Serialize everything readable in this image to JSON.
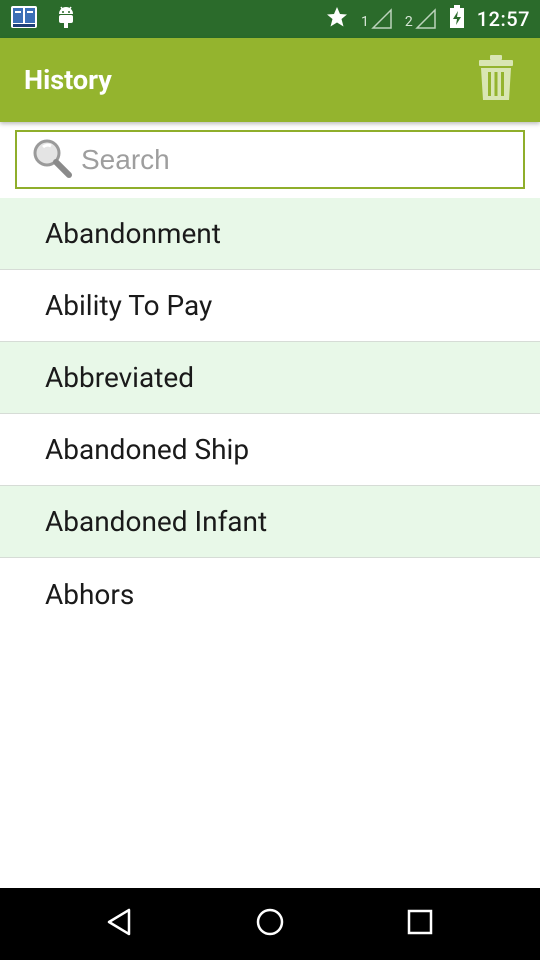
{
  "status_bar": {
    "time": "12:57",
    "sim1_label": "1",
    "sim2_label": "2",
    "icons": [
      "dictionary-app-icon",
      "android-debug-icon",
      "star-icon",
      "signal-icon",
      "signal-icon",
      "battery-charging-icon"
    ]
  },
  "app_bar": {
    "title": "History",
    "action_icon": "trash-icon",
    "color": "#94b42e"
  },
  "search": {
    "placeholder": "Search",
    "value": ""
  },
  "history": {
    "items": [
      {
        "label": "Abandonment"
      },
      {
        "label": "Ability To Pay"
      },
      {
        "label": "Abbreviated"
      },
      {
        "label": "Abandoned Ship"
      },
      {
        "label": "Abandoned Infant"
      },
      {
        "label": "Abhors"
      }
    ]
  },
  "nav_bar": {
    "icons": [
      "back-icon",
      "home-icon",
      "recents-icon"
    ]
  },
  "colors": {
    "status_bar": "#2b6b2b",
    "row_highlight": "#e8f8e8",
    "accent": "#8fae2b"
  }
}
